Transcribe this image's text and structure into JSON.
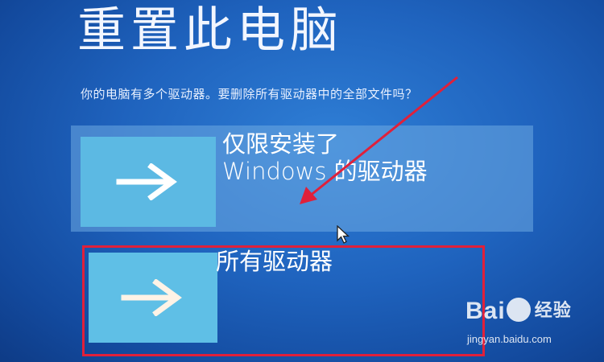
{
  "window": {
    "title": "重置此电脑",
    "question": "你的电脑有多个驱动器。要删除所有驱动器中的全部文件吗？"
  },
  "options": [
    {
      "line1": "仅限安装了",
      "line2": "Windows 的驱动器",
      "icon": "arrow-right-icon"
    },
    {
      "line1": "所有驱动器",
      "icon": "arrow-right-icon"
    }
  ],
  "annotation": {
    "color": "#e0203a"
  },
  "watermark": {
    "logo_part1": "Bai",
    "logo_part2": "经验",
    "url": "jingyan.baidu.com"
  },
  "colors": {
    "background": "#1f63be",
    "tile": "#5fbfe6",
    "highlight": "#e0203a"
  }
}
